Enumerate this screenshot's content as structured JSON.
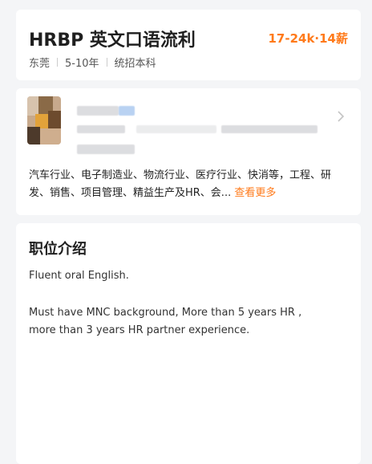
{
  "job": {
    "title": "HRBP 英文口语流利",
    "salary": "17-24k·14薪",
    "location": "东莞",
    "experience": "5-10年",
    "education": "统招本科"
  },
  "company": {
    "avatar_icon": "company-logo-blurred",
    "industries": "汽车行业、电子制造业、物流行业、医疗行业、快消等，工程、研发、销售、项目管理、精益生产及HR、会...",
    "more_label": "查看更多",
    "chevron_icon": "chevron-right-icon"
  },
  "description": {
    "heading": "职位介绍",
    "lines": [
      "Fluent oral English.",
      "Must have MNC background,  More than 5 years HR ,",
      "more than 3 years HR partner experience."
    ]
  },
  "colors": {
    "accent": "#ff7a1a",
    "card_bg": "#ffffff",
    "page_bg": "#f4f5f7"
  }
}
